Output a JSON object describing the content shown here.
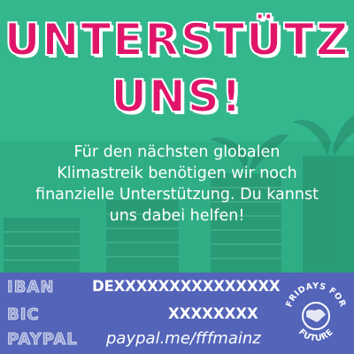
{
  "headline": {
    "line1": "UNTERSTÜTZ",
    "line2": "UNS!"
  },
  "body": {
    "lines": [
      "Für den nächsten globalen",
      "Klimastreik benötigen wir noch",
      "finanzielle Unterstützung. Du kannst",
      "uns dabei helfen!"
    ]
  },
  "bank": {
    "iban_label": "IBAN",
    "iban_value": "DEXXXXXXXXXXXXXXX",
    "bic_label": "BIC",
    "bic_value": "XXXXXXXX",
    "paypal_label": "PAYPAL",
    "paypal_value": "paypal.me/fffmainz"
  },
  "logo": {
    "text": "FRIDAYS FOR FUTURE",
    "icon": "globe-icon"
  },
  "colors": {
    "accent": "#e0156a",
    "green": "#2fae86",
    "purple": "#5c54c4"
  }
}
